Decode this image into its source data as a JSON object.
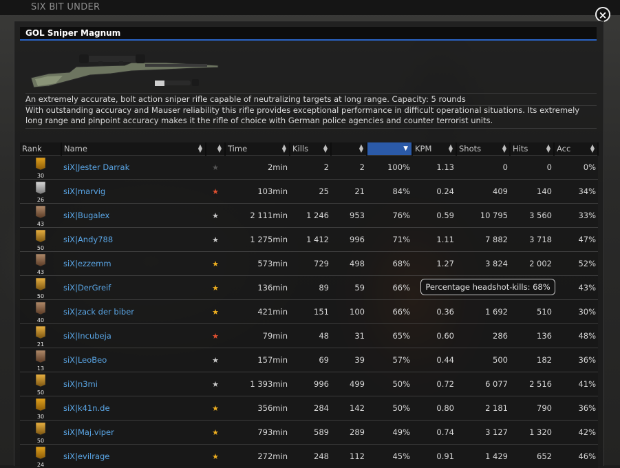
{
  "site": {
    "title": "SIX BIT UNDER",
    "close_label": "×"
  },
  "weapon": {
    "name": "GOL Sniper Magnum",
    "description_1": "An extremely accurate, bolt action sniper rifle capable of neutralizing targets at long range. Capacity: 5 rounds",
    "description_2": "With outstanding accuracy and Mauser reliability this rifle provides exceptional performance in difficult operational situations. Its extremely long range and pinpoint accuracy makes it the rifle of choice with German police agencies and counter terrorist units."
  },
  "table": {
    "columns": {
      "rank": "Rank",
      "name": "Name",
      "star": "",
      "time": "Time",
      "kills": "Kills",
      "headshots": "",
      "hs_pct": "",
      "kpm": "KPM",
      "shots": "Shots",
      "hits": "Hits",
      "acc": "Acc"
    },
    "sorted_column": "hs_pct",
    "rows": [
      {
        "rank": "30",
        "rank_icon": "gold-bars",
        "name": "siX|Jester Darrak",
        "star": "grey",
        "time": "2min",
        "kills": "2",
        "headshots": "2",
        "hs_pct": "100%",
        "kpm": "1.13",
        "shots": "0",
        "hits": "0",
        "acc": "0%"
      },
      {
        "rank": "26",
        "rank_icon": "silver-bar",
        "name": "siX|marvig",
        "star": "red",
        "time": "103min",
        "kills": "25",
        "headshots": "21",
        "hs_pct": "84%",
        "kpm": "0.24",
        "shots": "409",
        "hits": "140",
        "acc": "34%"
      },
      {
        "rank": "43",
        "rank_icon": "bronze-stars",
        "name": "siX|Bugalex",
        "star": "silver",
        "time": "2 111min",
        "kills": "1 246",
        "headshots": "953",
        "hs_pct": "76%",
        "kpm": "0.59",
        "shots": "10 795",
        "hits": "3 560",
        "acc": "33%"
      },
      {
        "rank": "50",
        "rank_icon": "gold-wreath",
        "name": "siX|Andy788",
        "star": "silver",
        "time": "1 275min",
        "kills": "1 412",
        "headshots": "996",
        "hs_pct": "71%",
        "kpm": "1.11",
        "shots": "7 882",
        "hits": "3 718",
        "acc": "47%"
      },
      {
        "rank": "43",
        "rank_icon": "bronze-stars",
        "name": "siX|ezzemm",
        "star": "gold",
        "time": "573min",
        "kills": "729",
        "headshots": "498",
        "hs_pct": "68%",
        "kpm": "1.27",
        "shots": "3 824",
        "hits": "2 002",
        "acc": "52%"
      },
      {
        "rank": "50",
        "rank_icon": "gold-wreath",
        "name": "siX|DerGreif",
        "star": "gold",
        "time": "136min",
        "kills": "89",
        "headshots": "59",
        "hs_pct": "66%",
        "kpm": "",
        "shots": "",
        "hits": "",
        "acc": "43%"
      },
      {
        "rank": "40",
        "rank_icon": "bronze-stars",
        "name": "siX|zack der biber",
        "star": "gold",
        "time": "421min",
        "kills": "151",
        "headshots": "100",
        "hs_pct": "66%",
        "kpm": "0.36",
        "shots": "1 692",
        "hits": "510",
        "acc": "30%"
      },
      {
        "rank": "21",
        "rank_icon": "gold-chevron",
        "name": "siX|Incubeja",
        "star": "red",
        "time": "79min",
        "kills": "48",
        "headshots": "31",
        "hs_pct": "65%",
        "kpm": "0.60",
        "shots": "286",
        "hits": "136",
        "acc": "48%"
      },
      {
        "rank": "13",
        "rank_icon": "bronze-chevron",
        "name": "siX|LeoBeo",
        "star": "silver",
        "time": "157min",
        "kills": "69",
        "headshots": "39",
        "hs_pct": "57%",
        "kpm": "0.44",
        "shots": "500",
        "hits": "182",
        "acc": "36%"
      },
      {
        "rank": "50",
        "rank_icon": "gold-wreath",
        "name": "siX|n3mi",
        "star": "silver",
        "time": "1 393min",
        "kills": "996",
        "headshots": "499",
        "hs_pct": "50%",
        "kpm": "0.72",
        "shots": "6 077",
        "hits": "2 516",
        "acc": "41%"
      },
      {
        "rank": "30",
        "rank_icon": "gold-bars",
        "name": "siX|k41n.de",
        "star": "gold",
        "time": "356min",
        "kills": "284",
        "headshots": "142",
        "hs_pct": "50%",
        "kpm": "0.80",
        "shots": "2 181",
        "hits": "790",
        "acc": "36%"
      },
      {
        "rank": "50",
        "rank_icon": "gold-wreath",
        "name": "siX|Maj.viper",
        "star": "gold",
        "time": "793min",
        "kills": "589",
        "headshots": "289",
        "hs_pct": "49%",
        "kpm": "0.74",
        "shots": "3 127",
        "hits": "1 320",
        "acc": "42%"
      },
      {
        "rank": "24",
        "rank_icon": "gold-bars",
        "name": "siX|evilrage",
        "star": "gold",
        "time": "272min",
        "kills": "248",
        "headshots": "112",
        "hs_pct": "45%",
        "kpm": "0.91",
        "shots": "1 429",
        "hits": "652",
        "acc": "46%"
      }
    ]
  },
  "tooltip": {
    "text": "Percentage headshot-kills: 68%"
  },
  "colors": {
    "accent": "#2b5aa8",
    "link": "#5aa6e6",
    "star_gold": "#f0b020",
    "star_red": "#e05030",
    "star_silver": "#c8c8c8",
    "star_grey": "#555555"
  }
}
